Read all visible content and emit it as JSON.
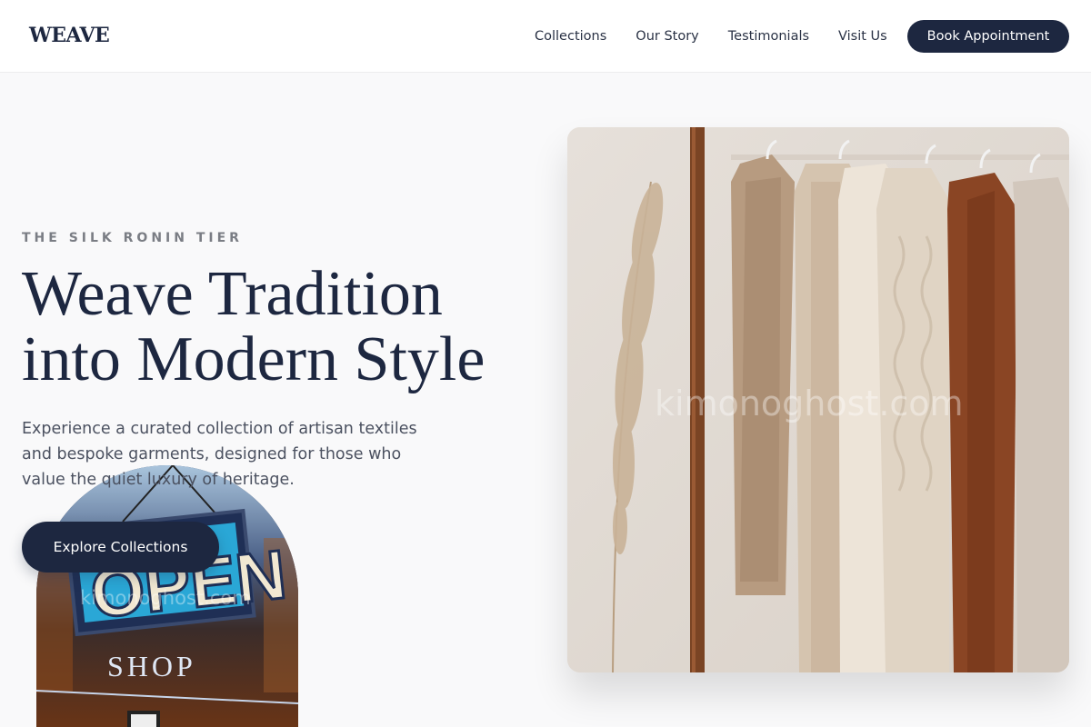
{
  "header": {
    "logo": "WEAVE",
    "nav": [
      "Collections",
      "Our Story",
      "Testimonials",
      "Visit Us"
    ],
    "cta": "Book Appointment"
  },
  "hero": {
    "eyebrow": "THE SILK RONIN TIER",
    "headline_line1": "Weave Tradition",
    "headline_line2": "into Modern Style",
    "subtext": "Experience a curated collection of artisan textiles and bespoke garments, designed for those who value the quiet luxury of heritage.",
    "cta": "Explore Collections"
  },
  "images": {
    "clothing_watermark": "kimonoghost.com",
    "shop_watermark": "kimonoghost.com",
    "shop_sign_open": "OPEN",
    "shop_sign_shop": "SHOP"
  },
  "colors": {
    "primary": "#1d2740",
    "background": "#f9f9fa",
    "eyebrow": "#7a7d84"
  }
}
